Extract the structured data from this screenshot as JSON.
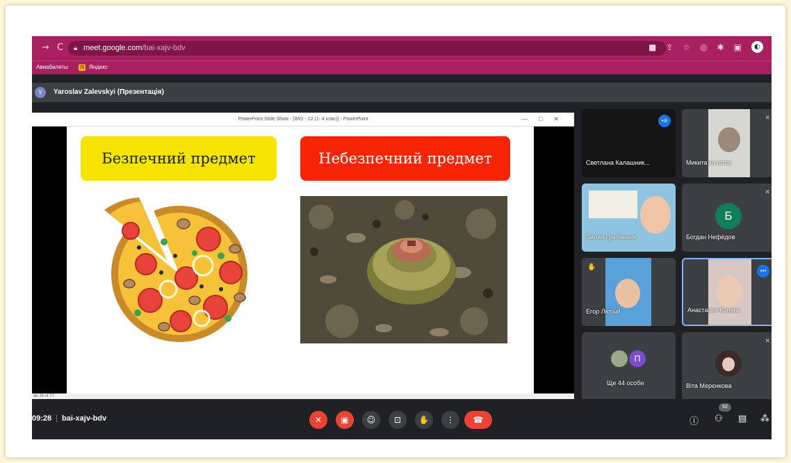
{
  "browser": {
    "back": "→",
    "reload": "C",
    "url_host": "meet.google.com",
    "url_path": "/bai-xajv-bdv",
    "bookmarks": [
      "Авиабилеты",
      "Яндекс"
    ],
    "toolbar_icons": [
      "cast-icon",
      "share-icon",
      "star-icon",
      "extension-icon",
      "puzzle-icon",
      "sidepanel-icon",
      "profile-icon"
    ]
  },
  "presenter": {
    "initial": "Y",
    "name": "Yaroslav Zalevskyi (Презентація)"
  },
  "powerpoint": {
    "window_title": "PowerPoint Slide Show - [IMO - 22 (1- 4 клас)] - PowerPoint",
    "status": "de 35 of 77",
    "slide": {
      "safe_label": "Безпечний предмет",
      "danger_label": "Небезпечний предмет"
    }
  },
  "participants": [
    {
      "name": "Светлана Калашник...",
      "status": "speaking"
    },
    {
      "name": "Микита кочетов",
      "status": "muted"
    },
    {
      "name": "Лилия Гребинник",
      "status": ""
    },
    {
      "name": "Богдан Нефёдов",
      "initial": "Б",
      "status": "muted"
    },
    {
      "name": "Егор Лютый",
      "status": "hand"
    },
    {
      "name": "Анастасия Конева",
      "status": "selected"
    },
    {
      "name": "Ще 44 особи",
      "initial": "П",
      "status": "more"
    },
    {
      "name": "Віта Мерєнкова",
      "status": "muted"
    }
  ],
  "meeting": {
    "time": "09:28",
    "code": "bai-xajv-bdv",
    "participant_count": "52"
  },
  "colors": {
    "chrome": "#a8205f",
    "meet_bg": "#202124",
    "tile": "#3c4043",
    "red": "#ea4335",
    "safe": "#f5e400",
    "danger": "#f52506"
  }
}
